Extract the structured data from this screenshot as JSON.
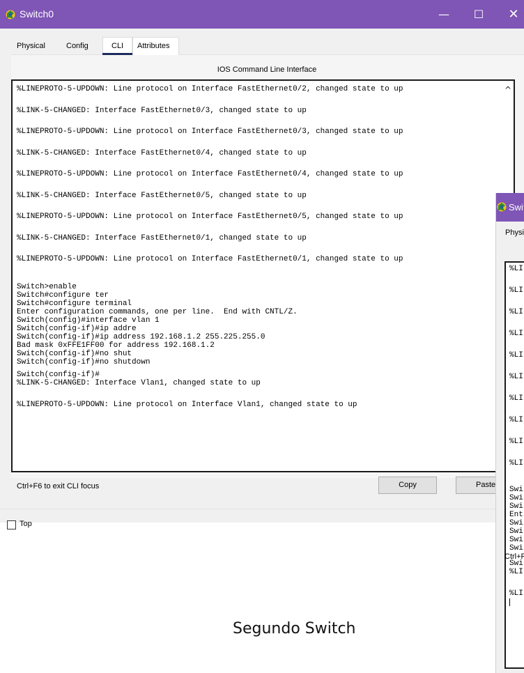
{
  "window": {
    "title": "Switch0",
    "controls": {
      "minimize": "—",
      "maximize": "☐",
      "close": "✕"
    },
    "title_color": "#7f55b6"
  },
  "tabs": [
    {
      "label": "Physical"
    },
    {
      "label": "Config"
    },
    {
      "label": "CLI"
    },
    {
      "label": "Attributes"
    }
  ],
  "active_tab": "CLI",
  "cli": {
    "heading": "IOS Command Line Interface",
    "log_lines": [
      "%LINEPROTO-5-UPDOWN: Line protocol on Interface FastEthernet0/2, changed state to up",
      "%LINK-5-CHANGED: Interface FastEthernet0/3, changed state to up",
      "%LINEPROTO-5-UPDOWN: Line protocol on Interface FastEthernet0/3, changed state to up",
      "%LINK-5-CHANGED: Interface FastEthernet0/4, changed state to up",
      "%LINEPROTO-5-UPDOWN: Line protocol on Interface FastEthernet0/4, changed state to up",
      "%LINK-5-CHANGED: Interface FastEthernet0/5, changed state to up",
      "%LINEPROTO-5-UPDOWN: Line protocol on Interface FastEthernet0/5, changed state to up",
      "%LINK-5-CHANGED: Interface FastEthernet0/1, changed state to up",
      "%LINEPROTO-5-UPDOWN: Line protocol on Interface FastEthernet0/1, changed state to up"
    ],
    "command_lines": [
      "Switch>enable",
      "Switch#configure ter",
      "Switch#configure terminal",
      "Enter configuration commands, one per line.  End with CNTL/Z.",
      "Switch(config)#interface vlan 1",
      "Switch(config-if)#ip addre",
      "Switch(config-if)#ip address 192.168.1.2 255.225.255.0",
      "Bad mask 0xFFE1FF00 for address 192.168.1.2",
      "Switch(config-if)#no shut",
      "Switch(config-if)#no shutdown"
    ],
    "tail_lines": [
      "Switch(config-if)#",
      "%LINK-5-CHANGED: Interface Vlan1, changed state to up"
    ],
    "last_line": "%LINEPROTO-5-UPDOWN: Line protocol on Interface Vlan1, changed state to up",
    "scroll_up": "^"
  },
  "footer": {
    "focus_hint": "Ctrl+F6 to exit CLI focus",
    "copy_label": "Copy",
    "paste_label": "Paste"
  },
  "top_checkbox": {
    "label": "Top",
    "checked": false
  },
  "caption": "Segundo Switch",
  "second_window": {
    "title": "Swit",
    "tab_label": "Physi",
    "cli_fragments": [
      "%LI",
      "%LI",
      "%LI",
      "%LI",
      "%LI",
      "%LI",
      "%LI",
      "%LI",
      "%LI",
      "%LI"
    ],
    "cli_cmd_fragments": [
      "Swi",
      "Swi",
      "Swi",
      "Ent",
      "Swi",
      "Swi",
      "Swi",
      "Swi"
    ],
    "cli_tail_fragments": [
      "Swi",
      "%LI"
    ],
    "cli_last_fragment": "%LI",
    "footer_fragment": "Ctrl+F"
  }
}
